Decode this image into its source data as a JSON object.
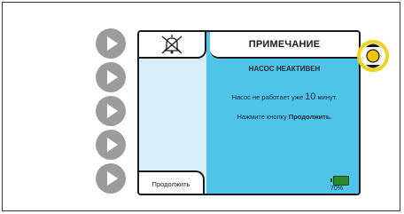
{
  "screen": {
    "title": "ПРИМЕЧАНИЕ",
    "subtitle": "НАСОС НЕАКТИВЕН",
    "message": {
      "prefix": "Насос не работает уже",
      "minutes": "10",
      "suffix": "минут.",
      "press_prefix": "Нажмите кнопку",
      "button_name": "Продолжить."
    },
    "softkey_label": "Продолжить",
    "battery_percent": "70%",
    "battery_level": 0.7
  },
  "icons": {
    "alarm": "alarm-silenced-bell-icon",
    "softkey": "play-arrow-icon",
    "indicator": "status-indicator-light-icon",
    "battery": "battery-icon"
  },
  "colors": {
    "screen_background": "#4fc3e8",
    "left_panel": "#d9eef8",
    "indicator_ring": "#f2d21b",
    "indicator_center": "#f7c200",
    "battery": "#2a8a2a",
    "softkey": "#9c9c9c"
  }
}
